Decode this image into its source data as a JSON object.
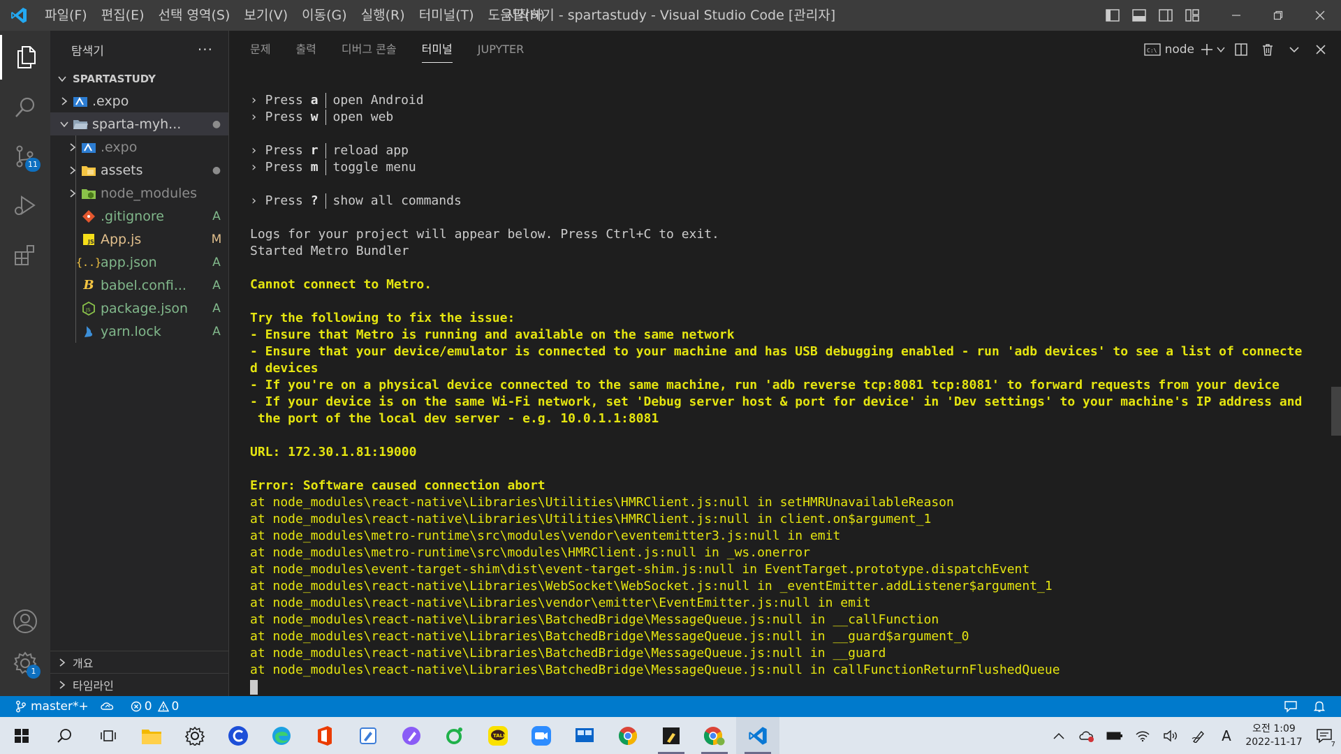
{
  "window": {
    "title": "시작하기 - spartastudy - Visual Studio Code [관리자]",
    "menu": [
      "파일(F)",
      "편집(E)",
      "선택 영역(S)",
      "보기(V)",
      "이동(G)",
      "실행(R)",
      "터미널(T)",
      "도움말(H)"
    ]
  },
  "activitybar": {
    "source_control_badge": "11",
    "settings_badge": "1"
  },
  "sidebar": {
    "title": "탐색기",
    "more": "···",
    "root": "SPARTASTUDY",
    "items": [
      {
        "name": ".expo",
        "deco": ""
      },
      {
        "name": "sparta-myh...",
        "deco": "●"
      },
      {
        "name": ".expo",
        "deco": ""
      },
      {
        "name": "assets",
        "deco": "●"
      },
      {
        "name": "node_modules",
        "deco": ""
      },
      {
        "name": ".gitignore",
        "deco": "A"
      },
      {
        "name": "App.js",
        "deco": "M"
      },
      {
        "name": "app.json",
        "deco": "A"
      },
      {
        "name": "babel.confi...",
        "deco": "A"
      },
      {
        "name": "package.json",
        "deco": "A"
      },
      {
        "name": "yarn.lock",
        "deco": "A"
      }
    ],
    "sections": [
      "개요",
      "타임라인"
    ]
  },
  "panel": {
    "tabs": [
      "문제",
      "출력",
      "디버그 콘솔",
      "터미널",
      "JUPYTER"
    ],
    "active_tab": "터미널",
    "terminal_name": "node"
  },
  "terminal": {
    "press_prefix": "› Press ",
    "keys": [
      {
        "key": "a",
        "desc": "open Android"
      },
      {
        "key": "w",
        "desc": "open web"
      },
      {
        "key": "r",
        "desc": "reload app"
      },
      {
        "key": "m",
        "desc": "toggle menu"
      },
      {
        "key": "?",
        "desc": "show all commands"
      }
    ],
    "logs_line": "Logs for your project will appear below. Press Ctrl+C to exit.",
    "started_line": "Started Metro Bundler",
    "cannot_connect": "Cannot connect to Metro.",
    "try_line": "Try the following to fix the issue:",
    "fixes": [
      "- Ensure that Metro is running and available on the same network",
      "- Ensure that your device/emulator is connected to your machine and has USB debugging enabled - run 'adb devices' to see a list of connecte",
      "d devices",
      "- If you're on a physical device connected to the same machine, run 'adb reverse tcp:8081 tcp:8081' to forward requests from your device",
      "- If your device is on the same Wi-Fi network, set 'Debug server host & port for device' in 'Dev settings' to your machine's IP address and",
      " the port of the local dev server - e.g. 10.0.1.1:8081"
    ],
    "url_line": "URL: 172.30.1.81:19000",
    "error_line": "Error: Software caused connection abort",
    "stack": [
      "at node_modules\\react-native\\Libraries\\Utilities\\HMRClient.js:null in setHMRUnavailableReason",
      "at node_modules\\react-native\\Libraries\\Utilities\\HMRClient.js:null in client.on$argument_1",
      "at node_modules\\metro-runtime\\src\\modules\\vendor\\eventemitter3.js:null in emit",
      "at node_modules\\metro-runtime\\src\\modules\\HMRClient.js:null in _ws.onerror",
      "at node_modules\\event-target-shim\\dist\\event-target-shim.js:null in EventTarget.prototype.dispatchEvent",
      "at node_modules\\react-native\\Libraries\\WebSocket\\WebSocket.js:null in _eventEmitter.addListener$argument_1",
      "at node_modules\\react-native\\Libraries\\vendor\\emitter\\EventEmitter.js:null in emit",
      "at node_modules\\react-native\\Libraries\\BatchedBridge\\MessageQueue.js:null in __callFunction",
      "at node_modules\\react-native\\Libraries\\BatchedBridge\\MessageQueue.js:null in __guard$argument_0",
      "at node_modules\\react-native\\Libraries\\BatchedBridge\\MessageQueue.js:null in __guard",
      "at node_modules\\react-native\\Libraries\\BatchedBridge\\MessageQueue.js:null in callFunctionReturnFlushedQueue"
    ]
  },
  "statusbar": {
    "branch": "master*+",
    "errors": "0",
    "warnings": "0"
  },
  "taskbar": {
    "ime": "A",
    "time": "오전 1:09",
    "date": "2022-11-17",
    "notifications": "7"
  },
  "colors": {
    "accent": "#007acc",
    "terminal_yellow": "#e5e510",
    "titlebar": "#3c3c3c",
    "sidebar": "#252526",
    "editor": "#1e1e1e"
  }
}
